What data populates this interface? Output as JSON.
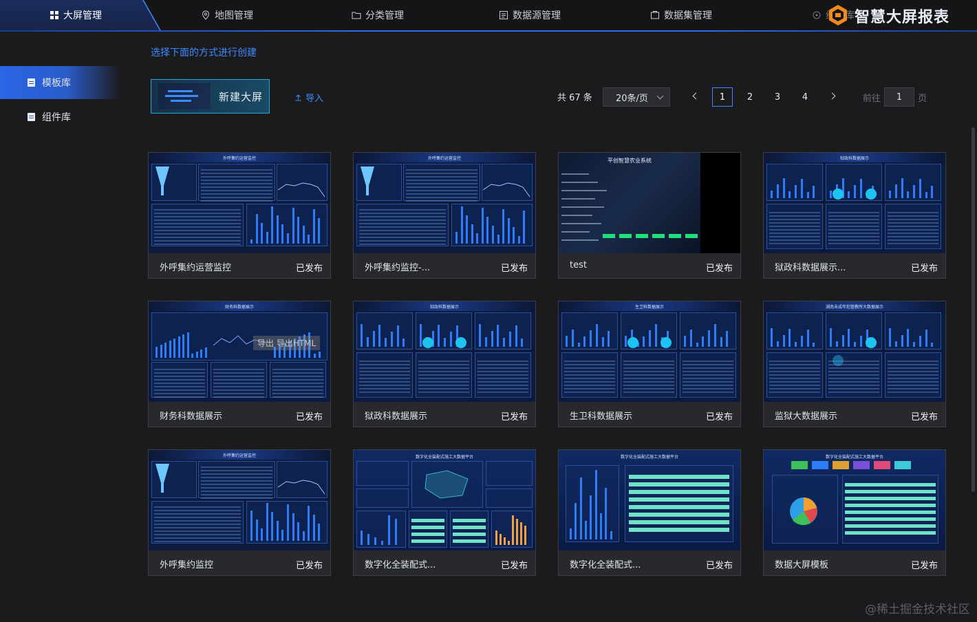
{
  "nav": {
    "tabs": [
      {
        "label": "大屏管理",
        "icon": "grid-icon",
        "active": true
      },
      {
        "label": "地图管理",
        "icon": "map-pin-icon"
      },
      {
        "label": "分类管理",
        "icon": "folder-icon"
      },
      {
        "label": "数据源管理",
        "icon": "database-icon"
      },
      {
        "label": "数据集管理",
        "icon": "dataset-icon"
      },
      {
        "label": "组件库",
        "icon": "component-icon"
      }
    ],
    "brand": "智慧大屏报表",
    "accent": "#2f6fe8"
  },
  "sidebar": {
    "items": [
      {
        "label": "模板库",
        "active": true
      },
      {
        "label": "组件库"
      }
    ]
  },
  "main": {
    "hint": "选择下面的方式进行创建",
    "new_label": "新建大屏",
    "import_label": "导入"
  },
  "pagination": {
    "total": "共 67 条",
    "page_size": "20条/页",
    "pages": [
      "1",
      "2",
      "3",
      "4"
    ],
    "current": "1",
    "goto_prefix": "前往",
    "goto_value": "1",
    "goto_suffix": "页"
  },
  "cards": [
    {
      "title": "外呼集约运营监控",
      "status": "已发布",
      "thumb_title": "外呼集约运营监控",
      "style": "callcenter"
    },
    {
      "title": "外呼集约监控-...",
      "status": "已发布",
      "thumb_title": "外呼集约运营监控",
      "style": "callcenter"
    },
    {
      "title": "test",
      "status": "已发布",
      "thumb_title": "平创智慧农业系统",
      "style": "agri"
    },
    {
      "title": "狱政科数据展示...",
      "status": "已发布",
      "thumb_title": "狱政科数据展示",
      "style": "prison"
    },
    {
      "title": "财务科数据展示",
      "status": "已发布",
      "thumb_title": "财务科数据展示",
      "style": "finance"
    },
    {
      "title": "狱政科数据展示",
      "status": "已发布",
      "thumb_title": "狱政科数据展示",
      "style": "prison"
    },
    {
      "title": "生卫科数据展示",
      "status": "已发布",
      "thumb_title": "生卫科数据展示",
      "style": "prison"
    },
    {
      "title": "监狱大数据展示",
      "status": "已发布",
      "thumb_title": "湖南未成年犯管教所大数据展示",
      "style": "prison2"
    },
    {
      "title": "外呼集约监控",
      "status": "已发布",
      "thumb_title": "外呼集约运营监控",
      "style": "callcenter"
    },
    {
      "title": "数字化全装配式...",
      "status": "已发布",
      "thumb_title": "数字化全装配式施工大数据平台",
      "style": "factory"
    },
    {
      "title": "数字化全装配式...",
      "status": "已发布",
      "thumb_title": "数字化全装配式施工大数据平台",
      "style": "factory2"
    },
    {
      "title": "数据大屏模板",
      "status": "已发布",
      "thumb_title": "数字化全装配式施工大数据平台",
      "style": "factory3"
    }
  ],
  "export_overlay": "导出 导出HTML",
  "watermark": "@稀土掘金技术社区"
}
